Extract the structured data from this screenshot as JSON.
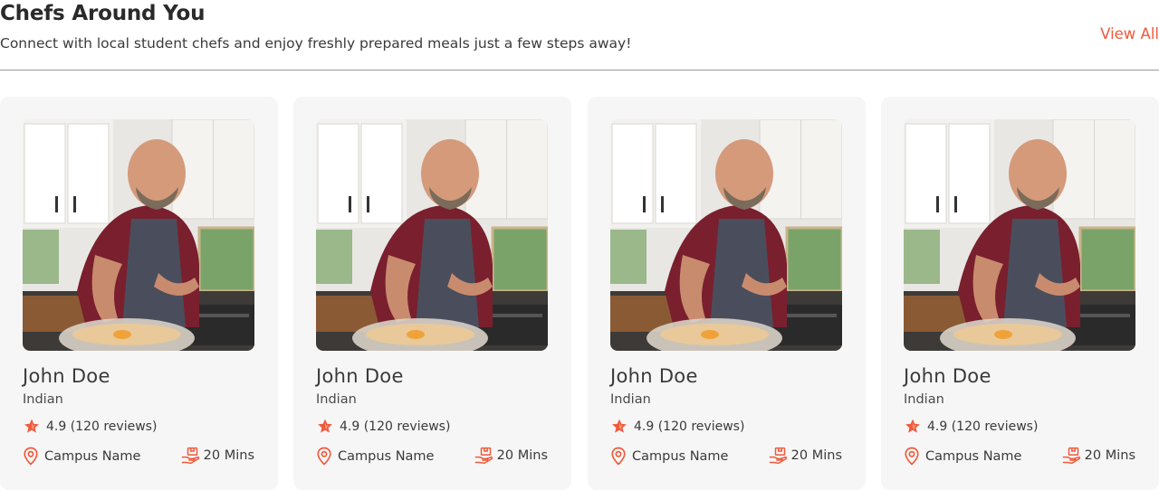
{
  "section": {
    "title": "Chefs Around You",
    "subtitle": "Connect with local student chefs and enjoy freshly prepared meals just a few steps away!",
    "view_all_label": "View All"
  },
  "colors": {
    "accent": "#f05a3c",
    "card_bg": "#f6f6f6"
  },
  "icons": {
    "rating": "star-icon",
    "location": "map-pin-icon",
    "time": "delivery-hand-icon"
  },
  "chefs": [
    {
      "name": "John Doe",
      "cuisine": "Indian",
      "rating": "4.9 (120 reviews)",
      "location": "Campus Name",
      "time": "20 Mins",
      "photo_alt": "Chef cooking in kitchen"
    },
    {
      "name": "John Doe",
      "cuisine": "Indian",
      "rating": "4.9 (120 reviews)",
      "location": "Campus Name",
      "time": "20 Mins",
      "photo_alt": "Chef cooking in kitchen"
    },
    {
      "name": "John Doe",
      "cuisine": "Indian",
      "rating": "4.9 (120 reviews)",
      "location": "Campus Name",
      "time": "20 Mins",
      "photo_alt": "Chef cooking in kitchen"
    },
    {
      "name": "John Doe",
      "cuisine": "Indian",
      "rating": "4.9 (120 reviews)",
      "location": "Campus Name",
      "time": "20 Mins",
      "photo_alt": "Chef cooking in kitchen"
    }
  ]
}
